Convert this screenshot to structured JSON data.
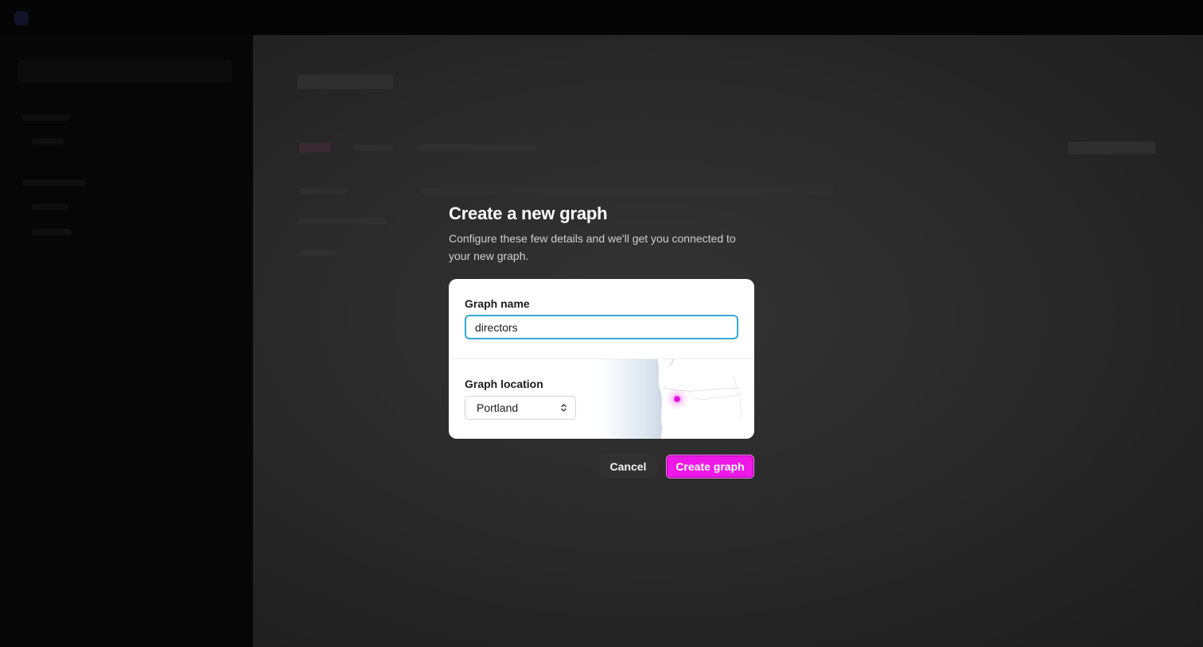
{
  "modal": {
    "title": "Create a new graph",
    "description": "Configure these few details and we'll get you connected to your new graph.",
    "name_field": {
      "label": "Graph name",
      "value": "directors"
    },
    "location_field": {
      "label": "Graph location",
      "selected": "Portland"
    },
    "cancel_label": "Cancel",
    "create_label": "Create graph"
  },
  "colors": {
    "accent": "#ee18e8",
    "input_focus": "#34a8d8",
    "overlay_bg": "#2a2a2a"
  },
  "icons": {
    "select_chevron": "chevron-up-down-icon",
    "map_marker": "location-pin-icon"
  }
}
